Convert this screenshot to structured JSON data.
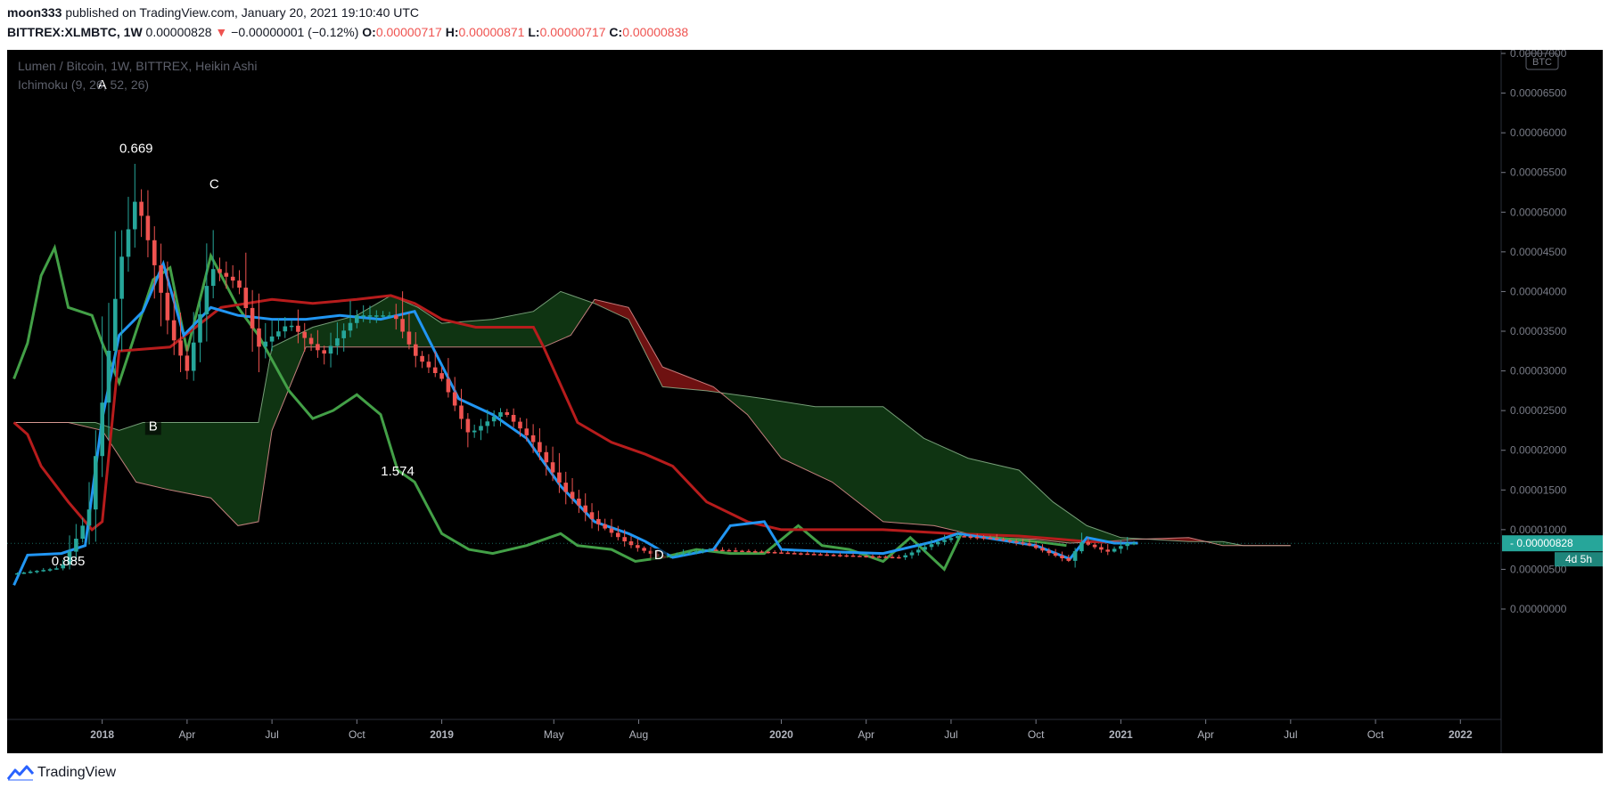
{
  "header": {
    "author": "moon333",
    "published_text": "published on TradingView.com, January 20, 2021 19:10:40 UTC",
    "symbol": "BITTREX:XLMBTC, 1W",
    "price": "0.00000828",
    "change": "−0.00000001 (−0.12%)",
    "o_label": "O:",
    "o_value": "0.00000717",
    "h_label": "H:",
    "h_value": "0.00000871",
    "l_label": "L:",
    "l_value": "0.00000717",
    "c_label": "C:",
    "c_value": "0.00000838"
  },
  "footer": {
    "brand": "TradingView"
  },
  "chart_data": {
    "type": "candlestick",
    "legend": [
      "Lumen / Bitcoin, 1W, BITTREX, Heikin Ashi",
      "Ichimoku (9, 26, 52, 26)"
    ],
    "currency_badge": "BTC",
    "y_ticks": [
      "0.00007000",
      "0.00006500",
      "0.00006000",
      "0.00005500",
      "0.00005000",
      "0.00004500",
      "0.00004000",
      "0.00003500",
      "0.00003000",
      "0.00002500",
      "0.00002000",
      "0.00001500",
      "0.00001000",
      "0.00000500",
      "0.00000000"
    ],
    "y_tick_values": [
      7e-05,
      6.5e-05,
      6e-05,
      5.5e-05,
      5e-05,
      4.5e-05,
      4e-05,
      3.5e-05,
      3e-05,
      2.5e-05,
      2e-05,
      1.5e-05,
      1e-05,
      5e-06,
      0
    ],
    "x_labels": [
      "2018",
      "Apr",
      "Jul",
      "Oct",
      "2019",
      "May",
      "Aug",
      "2020",
      "Apr",
      "Jul",
      "Oct",
      "2021",
      "Apr",
      "Jul",
      "Oct",
      "2022"
    ],
    "x_label_times": [
      2018.0,
      2018.25,
      2018.5,
      2018.75,
      2019.0,
      2019.33,
      2019.58,
      2020.0,
      2020.25,
      2020.5,
      2020.75,
      2021.0,
      2021.25,
      2021.5,
      2021.75,
      2022.0
    ],
    "last_price_label": "0.00000828",
    "countdown_label": "4d 5h",
    "annotations": [
      {
        "text": "A",
        "t": 2018.0,
        "v": 6.55e-05
      },
      {
        "text": "0.669",
        "t": 2018.1,
        "v": 5.75e-05
      },
      {
        "text": "C",
        "t": 2018.33,
        "v": 5.3e-05
      },
      {
        "text": "B",
        "t": 2018.15,
        "v": 2.25e-05
      },
      {
        "text": "1.574",
        "t": 2018.87,
        "v": 1.68e-05
      },
      {
        "text": "D",
        "t": 2019.64,
        "v": 6.3e-06
      },
      {
        "text": "0.885",
        "t": 2017.9,
        "v": 5.5e-06
      }
    ],
    "price_anchors": [
      [
        2017.75,
        4.5e-06
      ],
      [
        2017.88,
        5.2e-06
      ],
      [
        2017.96,
        1.2e-05
      ],
      [
        2018.0,
        2.6e-05
      ],
      [
        2018.05,
        4.3e-05
      ],
      [
        2018.1,
        5.2e-05
      ],
      [
        2018.15,
        4.4e-05
      ],
      [
        2018.2,
        3.5e-05
      ],
      [
        2018.25,
        3e-05
      ],
      [
        2018.32,
        4.3e-05
      ],
      [
        2018.4,
        4.1e-05
      ],
      [
        2018.46,
        3.3e-05
      ],
      [
        2018.55,
        3.6e-05
      ],
      [
        2018.65,
        3.2e-05
      ],
      [
        2018.75,
        3.7e-05
      ],
      [
        2018.86,
        3.7e-05
      ],
      [
        2018.92,
        3.2e-05
      ],
      [
        2019.0,
        2.9e-05
      ],
      [
        2019.08,
        2.2e-05
      ],
      [
        2019.18,
        2.5e-05
      ],
      [
        2019.27,
        2.1e-05
      ],
      [
        2019.36,
        1.5e-05
      ],
      [
        2019.45,
        1.1e-05
      ],
      [
        2019.55,
        8.2e-06
      ],
      [
        2019.64,
        6.5e-06
      ],
      [
        2019.78,
        7.5e-06
      ],
      [
        2019.95,
        7.2e-06
      ],
      [
        2020.15,
        6.8e-06
      ],
      [
        2020.35,
        6.5e-06
      ],
      [
        2020.45,
        8.3e-06
      ],
      [
        2020.52,
        9.2e-06
      ],
      [
        2020.62,
        8.9e-06
      ],
      [
        2020.72,
        8.2e-06
      ],
      [
        2020.85,
        6e-06
      ],
      [
        2020.88,
        8.5e-06
      ],
      [
        2020.96,
        7.2e-06
      ],
      [
        2021.02,
        8.3e-06
      ],
      [
        2021.05,
        8.3e-06
      ]
    ],
    "tenkan_sen": [
      [
        2017.74,
        3e-06
      ],
      [
        2017.78,
        6.8e-06
      ],
      [
        2017.88,
        7e-06
      ],
      [
        2017.95,
        8e-06
      ],
      [
        2018.0,
        2.4e-05
      ],
      [
        2018.05,
        3.45e-05
      ],
      [
        2018.12,
        3.75e-05
      ],
      [
        2018.18,
        4.35e-05
      ],
      [
        2018.24,
        3.45e-05
      ],
      [
        2018.32,
        3.8e-05
      ],
      [
        2018.4,
        3.7e-05
      ],
      [
        2018.5,
        3.65e-05
      ],
      [
        2018.6,
        3.65e-05
      ],
      [
        2018.7,
        3.7e-05
      ],
      [
        2018.82,
        3.65e-05
      ],
      [
        2018.92,
        3.75e-05
      ],
      [
        2019.05,
        2.65e-05
      ],
      [
        2019.15,
        2.45e-05
      ],
      [
        2019.25,
        2.15e-05
      ],
      [
        2019.35,
        1.55e-05
      ],
      [
        2019.45,
        1.1e-05
      ],
      [
        2019.55,
        9.5e-06
      ],
      [
        2019.6,
        8.5e-06
      ],
      [
        2019.68,
        6.5e-06
      ],
      [
        2019.8,
        7.5e-06
      ],
      [
        2019.85,
        1.05e-05
      ],
      [
        2019.95,
        1.1e-05
      ],
      [
        2020.0,
        7.5e-06
      ],
      [
        2020.15,
        7.2e-06
      ],
      [
        2020.3,
        7e-06
      ],
      [
        2020.45,
        8.5e-06
      ],
      [
        2020.52,
        9.5e-06
      ],
      [
        2020.6,
        9e-06
      ],
      [
        2020.75,
        8e-06
      ],
      [
        2020.85,
        6.3e-06
      ],
      [
        2020.9,
        9e-06
      ],
      [
        2020.98,
        8.3e-06
      ],
      [
        2021.05,
        8.3e-06
      ]
    ],
    "kijun_sen": [
      [
        2017.74,
        2.35e-05
      ],
      [
        2017.78,
        2.2e-05
      ],
      [
        2017.82,
        1.8e-05
      ],
      [
        2017.9,
        1.35e-05
      ],
      [
        2017.97,
        1e-05
      ],
      [
        2018.0,
        1.1e-05
      ],
      [
        2018.05,
        3.25e-05
      ],
      [
        2018.2,
        3.3e-05
      ],
      [
        2018.35,
        3.8e-05
      ],
      [
        2018.5,
        3.9e-05
      ],
      [
        2018.62,
        3.85e-05
      ],
      [
        2018.75,
        3.9e-05
      ],
      [
        2018.85,
        3.95e-05
      ],
      [
        2018.92,
        3.85e-05
      ],
      [
        2019.0,
        3.65e-05
      ],
      [
        2019.1,
        3.55e-05
      ],
      [
        2019.27,
        3.55e-05
      ],
      [
        2019.3,
        3.3e-05
      ],
      [
        2019.4,
        2.35e-05
      ],
      [
        2019.5,
        2.1e-05
      ],
      [
        2019.6,
        1.95e-05
      ],
      [
        2019.68,
        1.8e-05
      ],
      [
        2019.78,
        1.35e-05
      ],
      [
        2019.9,
        1.1e-05
      ],
      [
        2020.0,
        1e-05
      ],
      [
        2020.3,
        1e-05
      ],
      [
        2020.5,
        9.5e-06
      ],
      [
        2020.7,
        9.2e-06
      ],
      [
        2020.82,
        8.8e-06
      ],
      [
        2020.9,
        8.5e-06
      ],
      [
        2021.05,
        8.3e-06
      ]
    ],
    "chikou_span": [
      [
        2017.74,
        2.9e-05
      ],
      [
        2017.78,
        3.35e-05
      ],
      [
        2017.82,
        4.2e-05
      ],
      [
        2017.86,
        4.55e-05
      ],
      [
        2017.9,
        3.8e-05
      ],
      [
        2017.97,
        3.7e-05
      ],
      [
        2018.0,
        3.35e-05
      ],
      [
        2018.05,
        2.85e-05
      ],
      [
        2018.1,
        3.5e-05
      ],
      [
        2018.15,
        4.15e-05
      ],
      [
        2018.2,
        4.3e-05
      ],
      [
        2018.25,
        3.25e-05
      ],
      [
        2018.32,
        4.45e-05
      ],
      [
        2018.4,
        3.8e-05
      ],
      [
        2018.46,
        3.45e-05
      ],
      [
        2018.55,
        2.75e-05
      ],
      [
        2018.62,
        2.4e-05
      ],
      [
        2018.68,
        2.5e-05
      ],
      [
        2018.75,
        2.7e-05
      ],
      [
        2018.82,
        2.45e-05
      ],
      [
        2018.87,
        1.75e-05
      ],
      [
        2018.92,
        1.6e-05
      ],
      [
        2019.0,
        9.5e-06
      ],
      [
        2019.08,
        7.5e-06
      ],
      [
        2019.15,
        7e-06
      ],
      [
        2019.25,
        8e-06
      ],
      [
        2019.35,
        9.5e-06
      ],
      [
        2019.4,
        8e-06
      ],
      [
        2019.5,
        7.5e-06
      ],
      [
        2019.57,
        6e-06
      ],
      [
        2019.65,
        6.5e-06
      ],
      [
        2019.75,
        7.5e-06
      ],
      [
        2019.85,
        7e-06
      ],
      [
        2019.95,
        7e-06
      ],
      [
        2020.05,
        1.05e-05
      ],
      [
        2020.12,
        8e-06
      ],
      [
        2020.2,
        7.5e-06
      ],
      [
        2020.3,
        6e-06
      ],
      [
        2020.38,
        9e-06
      ],
      [
        2020.48,
        5e-06
      ],
      [
        2020.53,
        9.5e-06
      ],
      [
        2020.62,
        9e-06
      ],
      [
        2020.75,
        8.5e-06
      ],
      [
        2020.84,
        8e-06
      ]
    ],
    "senkou_span_a": [
      [
        2017.74,
        2.35e-05
      ],
      [
        2017.88,
        2.35e-05
      ],
      [
        2017.98,
        2.35e-05
      ],
      [
        2018.05,
        2.25e-05
      ],
      [
        2018.12,
        2.35e-05
      ],
      [
        2018.25,
        2.35e-05
      ],
      [
        2018.46,
        2.35e-05
      ],
      [
        2018.5,
        3.3e-05
      ],
      [
        2018.62,
        3.55e-05
      ],
      [
        2018.75,
        3.7e-05
      ],
      [
        2018.85,
        3.95e-05
      ],
      [
        2018.93,
        3.8e-05
      ],
      [
        2019.0,
        3.6e-05
      ],
      [
        2019.15,
        3.65e-05
      ],
      [
        2019.27,
        3.75e-05
      ],
      [
        2019.35,
        4e-05
      ],
      [
        2019.45,
        3.85e-05
      ],
      [
        2019.55,
        3.65e-05
      ],
      [
        2019.65,
        2.8e-05
      ],
      [
        2019.78,
        2.75e-05
      ],
      [
        2019.95,
        2.65e-05
      ],
      [
        2020.1,
        2.55e-05
      ],
      [
        2020.3,
        2.55e-05
      ],
      [
        2020.42,
        2.15e-05
      ],
      [
        2020.55,
        1.9e-05
      ],
      [
        2020.7,
        1.75e-05
      ],
      [
        2020.8,
        1.35e-05
      ],
      [
        2020.9,
        1.05e-05
      ],
      [
        2021.0,
        9e-06
      ],
      [
        2021.2,
        8.5e-06
      ],
      [
        2021.3,
        8.5e-06
      ],
      [
        2021.36,
        8e-06
      ],
      [
        2021.5,
        8e-06
      ]
    ],
    "senkou_span_b": [
      [
        2017.74,
        2.35e-05
      ],
      [
        2017.9,
        2.35e-05
      ],
      [
        2018.0,
        2.25e-05
      ],
      [
        2018.1,
        1.6e-05
      ],
      [
        2018.2,
        1.5e-05
      ],
      [
        2018.32,
        1.4e-05
      ],
      [
        2018.4,
        1.05e-05
      ],
      [
        2018.46,
        1.1e-05
      ],
      [
        2018.5,
        2.25e-05
      ],
      [
        2018.6,
        3.3e-05
      ],
      [
        2018.75,
        3.3e-05
      ],
      [
        2018.95,
        3.3e-05
      ],
      [
        2019.1,
        3.3e-05
      ],
      [
        2019.3,
        3.3e-05
      ],
      [
        2019.38,
        3.45e-05
      ],
      [
        2019.45,
        3.9e-05
      ],
      [
        2019.55,
        3.8e-05
      ],
      [
        2019.65,
        3.05e-05
      ],
      [
        2019.8,
        2.8e-05
      ],
      [
        2019.9,
        2.45e-05
      ],
      [
        2020.0,
        1.9e-05
      ],
      [
        2020.15,
        1.6e-05
      ],
      [
        2020.3,
        1.1e-05
      ],
      [
        2020.45,
        1.05e-05
      ],
      [
        2020.6,
        9e-06
      ],
      [
        2020.75,
        8.8e-06
      ],
      [
        2020.85,
        8.3e-06
      ],
      [
        2020.95,
        8.5e-06
      ],
      [
        2021.05,
        8.8e-06
      ],
      [
        2021.2,
        9e-06
      ],
      [
        2021.3,
        8e-06
      ],
      [
        2021.5,
        8e-06
      ]
    ],
    "colors": {
      "background": "#000000",
      "up_candle": "#26a69a",
      "down_candle": "#ef5350",
      "tenkan": "#2196f3",
      "kijun": "#b71c1c",
      "chikou": "#43a047",
      "span_a": "#a5d6a7",
      "span_b": "#ef9a9a",
      "cloud_bull": "#1b5e20",
      "cloud_bear": "#b71c1c",
      "axis_text": "#787b86",
      "last_price_bg": "#26a69a"
    }
  }
}
